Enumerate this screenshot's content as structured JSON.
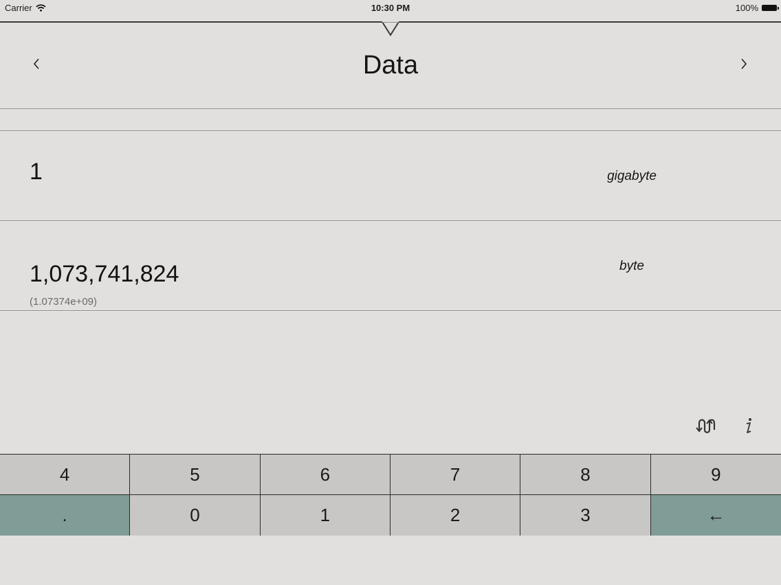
{
  "status_bar": {
    "carrier": "Carrier",
    "time": "10:30 PM",
    "battery": "100%"
  },
  "header": {
    "title": "Data",
    "prev_icon": "chevron-left-icon",
    "next_icon": "chevron-right-icon"
  },
  "rows": [
    {
      "value": "1",
      "unit": "gigabyte",
      "sci": ""
    },
    {
      "value": "1,073,741,824",
      "unit": "byte",
      "sci": "(1.07374e+09)"
    }
  ],
  "tools": {
    "swap_icon": "swap-icon",
    "info_icon": "info-icon"
  },
  "keypad": {
    "row1": [
      "4",
      "5",
      "6",
      "7",
      "8",
      "9"
    ],
    "row2": [
      ".",
      "0",
      "1",
      "2",
      "3",
      "←"
    ]
  },
  "colors": {
    "background": "#e2e0de",
    "key": "#c9c7c5",
    "accent_key": "#7f9c96"
  }
}
